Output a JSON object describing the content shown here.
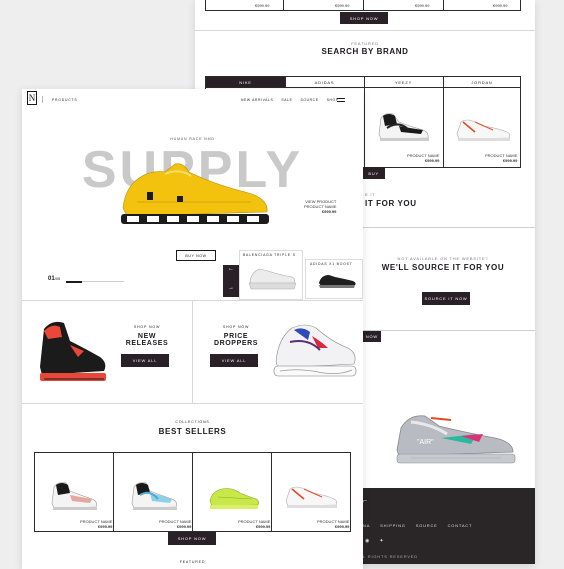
{
  "back": {
    "top_prices": [
      "€999.99",
      "€999.99",
      "€999.99",
      "€999.99"
    ],
    "top_shop": "SHOP NOW",
    "featured_kicker": "FEATURED",
    "brand_title": "SEARCH BY BRAND",
    "brand_tabs": [
      "NIKE",
      "ADIDAS",
      "YEEZY",
      "JORDAN"
    ],
    "brand_products": [
      {
        "label": "PRODUCT NAME",
        "price": "€999.99"
      },
      {
        "label": "PRODUCT NAME",
        "price": "€999.99"
      }
    ],
    "buy_partial": "BUY",
    "partial_kicker": "E IT",
    "partial_title": "IT FOR YOU",
    "source_kicker": "NOT AVAILABLE ON THE WEBSITE?",
    "source_title": "WE'LL SOURCE IT FOR YOU",
    "source_button": "SOURCE IT NOW",
    "now_partial": "NOW",
    "footer_links": [
      "NA",
      "SHIPPING",
      "SOURCE",
      "CONTACT"
    ],
    "footer_copy": "L RIGHTS RESERVED"
  },
  "front": {
    "logo": "N",
    "nav_left": "PRODUCTS",
    "nav": [
      "NEW ARRIVALS",
      "SALE",
      "SOURCE",
      "SHOP"
    ],
    "hero_kicker": "HUMAN RACE NMD",
    "hero_title": "SUPPLY",
    "hero_view": "VIEW PRODUCT",
    "hero_product": "PRODUCT NAME",
    "hero_price": "€999.99",
    "buy_now": "BUY NOW",
    "slide_current": "01",
    "slide_total": "/05",
    "prev_arrow": "←",
    "next_arrow": "→",
    "thumb1": "BALENCIAGA TRIPLE S",
    "thumb2": "ADIDAS X1 BOOST",
    "new_kicker": "SHOP NOW",
    "new_title": "NEW RELEASES",
    "new_btn": "VIEW ALL",
    "drop_kicker": "SHOP NOW",
    "drop_title": "PRICE DROPPERS",
    "drop_btn": "VIEW ALL",
    "best_kicker": "COLLECTIONS",
    "best_title": "BEST SELLERS",
    "products": [
      {
        "label": "PRODUCT NAME",
        "price": "€999.99"
      },
      {
        "label": "PRODUCT NAME",
        "price": "€999.99"
      },
      {
        "label": "PRODUCT NAME",
        "price": "€999.99"
      },
      {
        "label": "PRODUCT NAME",
        "price": "€999.99"
      }
    ],
    "shop_now": "SHOP NOW",
    "featured": "FEATURED"
  },
  "colors": {
    "accent": "#2a2028",
    "hero_shoe": "#f2c20f",
    "bg": "#eeeeef"
  }
}
